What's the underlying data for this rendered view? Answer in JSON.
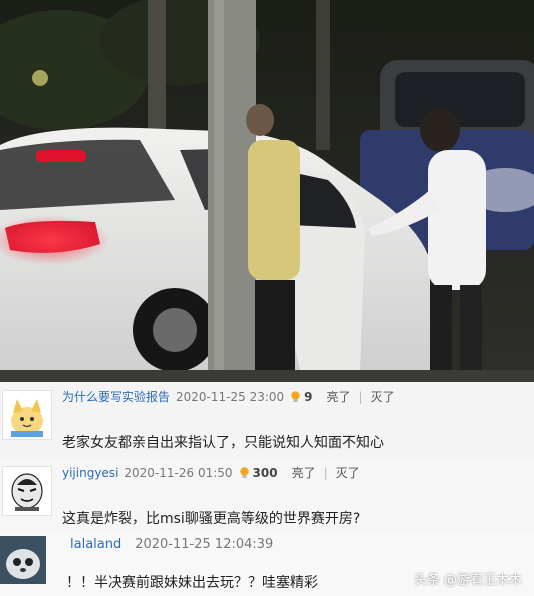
{
  "comments": [
    {
      "username": "为什么要写实验报告",
      "time": "2020-11-25 23:00",
      "likes": "9",
      "action_like": "亮了",
      "action_dislike": "灭了",
      "text": "老家女友都亲自出来指认了，只能说知人知面不知心"
    },
    {
      "username": "yijingyesi",
      "time": "2020-11-26 01:50",
      "likes": "300",
      "action_like": "亮了",
      "action_dislike": "灭了",
      "text": "这真是炸裂，比msi聊骚更高等级的世界赛开房?"
    },
    {
      "username": "lalaland",
      "time": "2020-11-25 12:04:39",
      "text": "！！半决赛前跟妹妹出去玩？？哇塞精彩"
    }
  ],
  "watermark": "头条 @游宥王木木",
  "colors": {
    "username": "#2b6bb8",
    "bulb": "#f5a623",
    "taillight": "#e0112b"
  }
}
